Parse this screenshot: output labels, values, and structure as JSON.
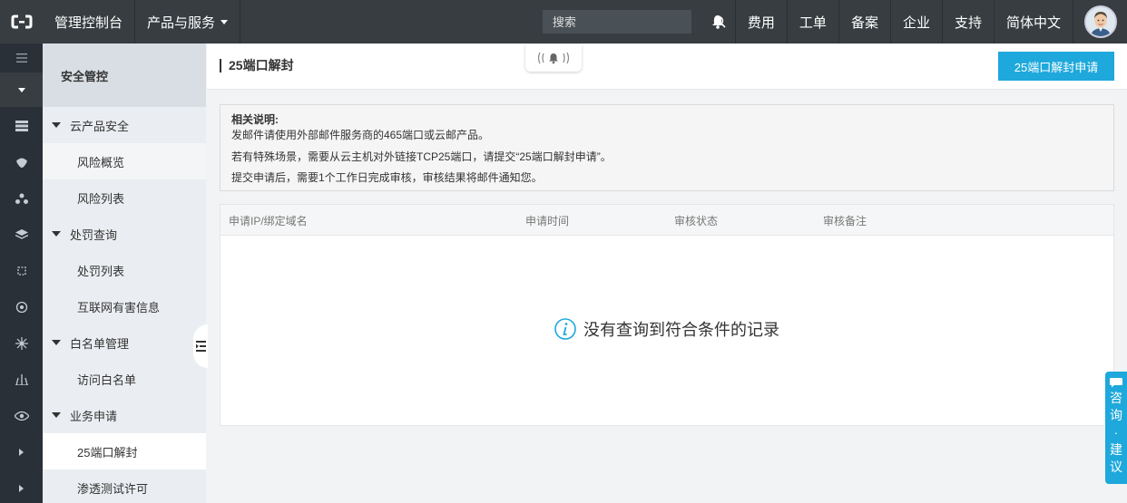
{
  "topbar": {
    "console": "管理控制台",
    "products": "产品与服务",
    "search_placeholder": "搜索",
    "right_items": [
      "费用",
      "工单",
      "备案",
      "企业",
      "支持",
      "简体中文"
    ]
  },
  "sidebar": {
    "title": "安全管控",
    "items": [
      {
        "type": "group",
        "label": "云产品安全"
      },
      {
        "type": "sub",
        "label": "风险概览"
      },
      {
        "type": "sub",
        "label": "风险列表"
      },
      {
        "type": "group",
        "label": "处罚查询"
      },
      {
        "type": "sub",
        "label": "处罚列表"
      },
      {
        "type": "sub",
        "label": "互联网有害信息"
      },
      {
        "type": "group",
        "label": "白名单管理"
      },
      {
        "type": "sub",
        "label": "访问白名单"
      },
      {
        "type": "group",
        "label": "业务申请"
      },
      {
        "type": "sub",
        "label": "25端口解封"
      },
      {
        "type": "sub",
        "label": "渗透测试许可"
      }
    ]
  },
  "header": {
    "title": "25端口解封",
    "apply_button": "25端口解封申请"
  },
  "notice": {
    "title": "相关说明:",
    "lines": [
      "发邮件请使用外部邮件服务商的465端口或云邮产品。",
      "若有特殊场景，需要从云主机对外链接TCP25端口，请提交“25端口解封申请”。",
      "提交申请后，需要1个工作日完成审核，审核结果将邮件通知您。"
    ]
  },
  "table": {
    "columns": [
      "申请IP/绑定域名",
      "申请时间",
      "审核状态",
      "审核备注"
    ],
    "empty_text": "没有查询到符合条件的记录"
  },
  "consult": [
    "咨",
    "询",
    "·",
    "建",
    "议"
  ],
  "colors": {
    "accent": "#1ea8db",
    "topbar": "#373d41",
    "rail": "#293038"
  }
}
